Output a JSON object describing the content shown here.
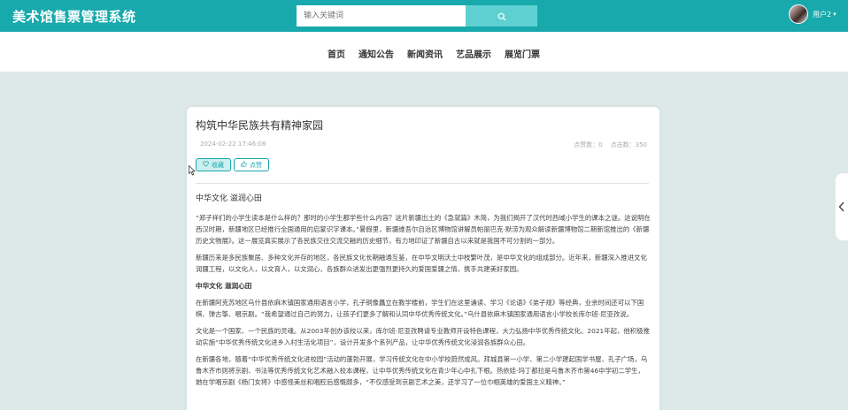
{
  "header": {
    "title": "美术馆售票管理系统",
    "search_placeholder": "输入关键词",
    "user_name": "用户2",
    "caret": "▾"
  },
  "nav": {
    "items": [
      "首页",
      "通知公告",
      "新闻资讯",
      "艺品展示",
      "展览门票"
    ]
  },
  "article": {
    "title": "构筑中华民族共有精神家园",
    "date": "2024-02-22 17:46:08",
    "likes_label": "点赞数：",
    "likes": "0",
    "views_label": "点击数：",
    "views": "350",
    "fav_label": "收藏",
    "like_label": "点赞",
    "heading": "中华文化 滋润心田",
    "para1": "“郑子祥们的小学生读本是什么样的？那时的小学生都学些什么内容？这片新疆出土的《急就篇》木简，为我们揭开了汉代时西域小学生的课本之谜。这说明在西汉时期，新疆地区已经推行全国通用的启蒙识字课本。”暑假里，新疆维吾尔自治区博物馆讲解员帕丽巴克·默涝为观众解读新疆博物馆二期新馆推出的《新疆历史文物展》。这一展览真实展示了各民族交往交流交融的历史细节，有力地印证了新疆自古以来就是我国不可分割的一部分。",
    "para2": "新疆历来是多民族聚居、多种文化并存的地区，各民族文化长期融通互鉴，在中华文明沃土中枝繁叶茂，是中华文化的组成部分。近年来，新疆深入推进文化润疆工程，以文化人，以文育人，以文润心，各族群众进发出更强烈更持久的爱国爱疆之情，携手共建美好家园。",
    "subheading": "中华文化 滋润心田",
    "para3": "在新疆阿克苏地区乌什县依麻木镇国家通用语言小学，孔子铜像矗立在教学楼前，学生们在这里诵读、学习《论语》《弟子规》等经典，业余时间还可以下国棋、弹古筝、唱京剧。“我希望通过自己的努力，让孩子们更多了解和认同中华优秀传统文化。”乌什县依麻木镇国家通用语言小学校长库尔班·尼亚孜说。",
    "para4": "文化是一个国家、一个民族的灵魂。从2003年创办该校以来，库尔班·尼亚孜聘请专业教师开设特色课程，大力弘扬中华优秀传统文化。2021年起，他积极推动实施“中华优秀传统文化进乡入村生活化项目”，设计开发多个系列产品，让中华优秀传统文化浸润各族群众心田。",
    "para5": "在新疆各地，随着“中华优秀传统文化进校园”活动的蓬勃开展，学习传统文化在中小学校蔚然成风。拜城县第一小学、第二小学建起国学书屋、孔子广场，乌鲁木齐市则将京剧、书法等优秀传统文化艺术融入校本课程，让中华优秀传统文化在青少年心中扎下根。热依娃·玛丁都拉是乌鲁木齐市第46中学初二学生，她在学唱京剧《杨门女将》中感怪美丝和唱腔后感慨颇多，“不仅感受到京剧艺术之美，还学习了一位巾帼英雄的爱国主义精神。”"
  },
  "colors": {
    "primary": "#17a9ac",
    "search_button": "#5fd0d2",
    "page_background": "#dde9e9"
  },
  "icons": [
    "search-icon",
    "heart-icon",
    "thumbs-up-icon",
    "chevron-left-icon",
    "mouse-cursor-icon"
  ]
}
